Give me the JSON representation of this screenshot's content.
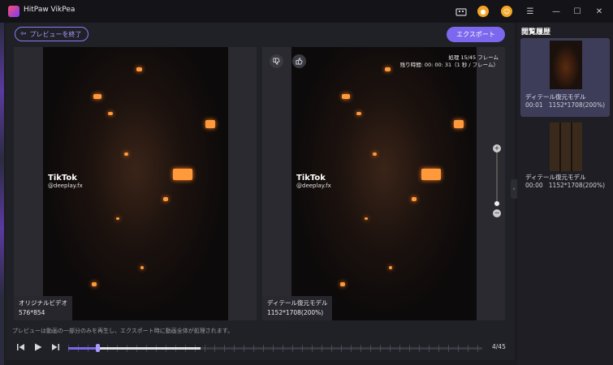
{
  "app": {
    "title": "HitPaw VikPea"
  },
  "titlebar_icons": {
    "gift": "gift-icon",
    "coin": "coin-icon",
    "user": "user-icon",
    "menu": "menu-icon",
    "minimize": "minimize-icon",
    "maximize": "maximize-icon",
    "close": "close-icon"
  },
  "toolbar": {
    "back_label": "プレビューを終了",
    "export_label": "エクスポート"
  },
  "left_pane": {
    "overlay_title": "TikTok",
    "overlay_handle": "@deeplay.fx",
    "label": "オリジナルビデオ",
    "resolution": "576*854"
  },
  "right_pane": {
    "overlay_title": "TikTok",
    "overlay_handle": "@deeplay.fx",
    "progress_line": "処理 15/45 フレーム",
    "remaining_line": "残り時間: 00: 00: 31（1 秒 / フレーム）",
    "label": "ディテール復元モデル",
    "resolution": "1152*1708(200%)",
    "dislike_icon": "thumbs-down-icon",
    "like_icon": "thumbs-up-icon"
  },
  "zoom": {
    "plus": "+",
    "minus": "−"
  },
  "notice": "プレビューは動画の一部分のみを再生し、エクスポート時に動画全体が処理されます。",
  "player": {
    "frame_count": "4/45",
    "progress_fraction": 0.07,
    "buffered_fraction": 0.32
  },
  "history": {
    "title": "閲覧履歴",
    "items": [
      {
        "name": "ディテール復元モデル",
        "time": "00:01",
        "size": "1152*1708(200%)"
      },
      {
        "name": "ディテール復元モデル",
        "time": "00:00",
        "size": "1152*1708(200%)"
      }
    ]
  },
  "colors": {
    "accent": "#7b68ee",
    "background": "#1b1b20"
  }
}
